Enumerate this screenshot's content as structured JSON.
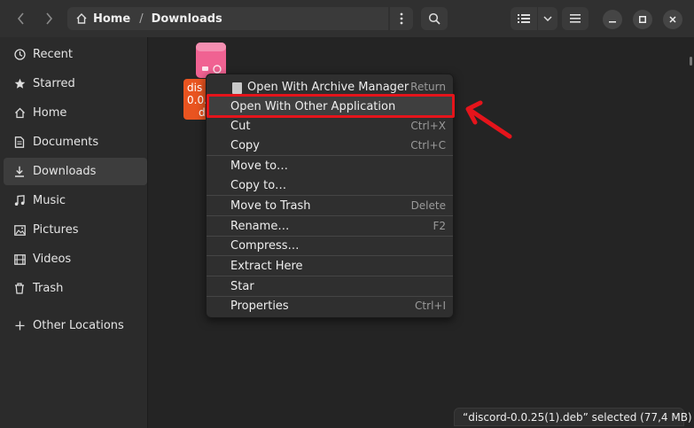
{
  "header": {
    "path": [
      "Home",
      "Downloads"
    ],
    "icons": {
      "back": "chevron-left-icon",
      "forward": "chevron-right-icon",
      "home": "home-icon",
      "path_menu": "kebab-icon",
      "search": "search-icon",
      "view": "list-view-icon",
      "view_dropdown": "chevron-down-icon",
      "menu": "hamburger-icon",
      "minimize": "minimize-icon",
      "maximize": "maximize-icon",
      "close": "close-icon"
    }
  },
  "sidebar": {
    "items": [
      {
        "label": "Recent",
        "icon": "clock-icon"
      },
      {
        "label": "Starred",
        "icon": "star-icon"
      },
      {
        "label": "Home",
        "icon": "home-icon"
      },
      {
        "label": "Documents",
        "icon": "document-icon"
      },
      {
        "label": "Downloads",
        "icon": "download-icon",
        "active": true
      },
      {
        "label": "Music",
        "icon": "music-icon"
      },
      {
        "label": "Pictures",
        "icon": "picture-icon"
      },
      {
        "label": "Videos",
        "icon": "video-icon"
      },
      {
        "label": "Trash",
        "icon": "trash-icon"
      },
      {
        "label": "Other Locations",
        "icon": "plus-icon"
      }
    ]
  },
  "file": {
    "label_lines": [
      "dis",
      "0.0.",
      "d"
    ],
    "icon": "package-icon",
    "accent": "#e95420"
  },
  "context_menu": {
    "items": [
      {
        "label": "Open With Archive Manager",
        "accel": "Return",
        "icon": "archive-icon"
      },
      {
        "label": "Open With Other Application",
        "accel": ""
      },
      {
        "label": "Cut",
        "accel": "Ctrl+X"
      },
      {
        "label": "Copy",
        "accel": "Ctrl+C"
      },
      {
        "label": "Move to…",
        "accel": ""
      },
      {
        "label": "Copy to…",
        "accel": ""
      },
      {
        "label": "Move to Trash",
        "accel": "Delete"
      },
      {
        "label": "Rename…",
        "accel": "F2"
      },
      {
        "label": "Compress…",
        "accel": ""
      },
      {
        "label": "Extract Here",
        "accel": ""
      },
      {
        "label": "Star",
        "accel": ""
      },
      {
        "label": "Properties",
        "accel": "Ctrl+I"
      }
    ],
    "highlight_color": "#e5141b"
  },
  "status": {
    "text": "“discord-0.0.25(1).deb” selected  (77,4 MB)"
  }
}
